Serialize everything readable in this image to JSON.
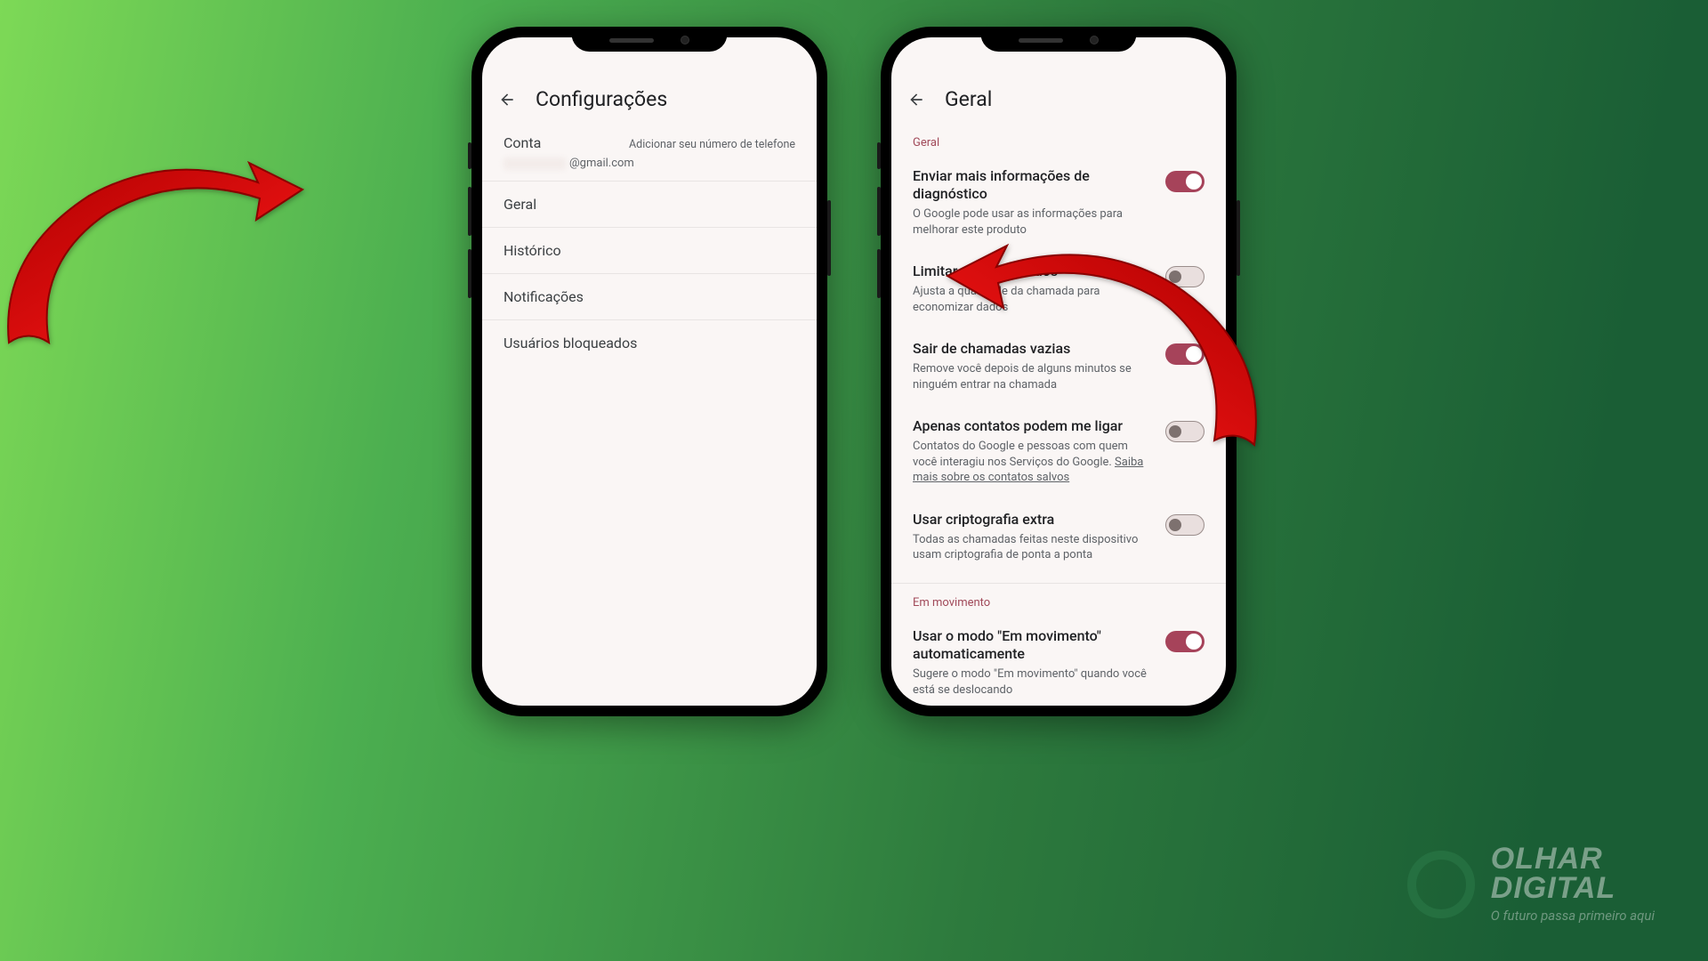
{
  "left": {
    "title": "Configurações",
    "account": {
      "label": "Conta",
      "add_phone": "Adicionar seu número de telefone",
      "email_suffix": "@gmail.com"
    },
    "items": [
      {
        "label": "Geral"
      },
      {
        "label": "Histórico"
      },
      {
        "label": "Notificações"
      },
      {
        "label": "Usuários bloqueados"
      }
    ]
  },
  "right": {
    "title": "Geral",
    "section_general": "Geral",
    "settings": [
      {
        "title": "Enviar mais informações de diagnóstico",
        "desc": "O Google pode usar as informações para melhorar este produto",
        "on": true
      },
      {
        "title": "Limitar o uso de dados",
        "desc": "Ajusta a qualidade da chamada para economizar dados",
        "on": false
      },
      {
        "title": "Sair de chamadas vazias",
        "desc": "Remove você depois de alguns minutos se ninguém entrar na chamada",
        "on": true
      },
      {
        "title": "Apenas contatos podem me ligar",
        "desc_before": "Contatos do Google e pessoas com quem você interagiu nos Serviços do Google. ",
        "link": "Saiba mais sobre os contatos salvos",
        "on": false
      },
      {
        "title": "Usar criptografia extra",
        "desc": "Todas as chamadas feitas neste dispositivo usam criptografia de ponta a ponta",
        "on": false
      }
    ],
    "section_moving": "Em movimento",
    "moving_setting": {
      "title": "Usar o modo \"Em movimento\" automaticamente",
      "desc": "Sugere o modo \"Em movimento\" quando você está se deslocando",
      "on": true
    }
  },
  "watermark": {
    "line1": "OLHAR",
    "line2": "DIGITAL",
    "tagline": "O futuro passa primeiro aqui"
  }
}
